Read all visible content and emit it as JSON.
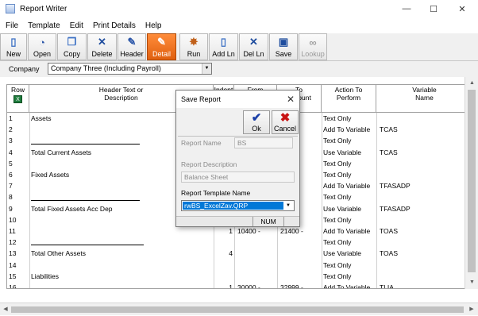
{
  "window": {
    "title": "Report Writer",
    "minimize": "—",
    "maximize": "☐",
    "close": "✕"
  },
  "menu": [
    "File",
    "Template",
    "Edit",
    "Print Details",
    "Help"
  ],
  "toolbar": [
    {
      "label": "New",
      "icon": "new-document-icon",
      "glyph": "▯"
    },
    {
      "label": "Open",
      "icon": "open-icon",
      "glyph": "◔"
    },
    {
      "label": "Copy",
      "icon": "copy-icon",
      "glyph": "❐"
    },
    {
      "label": "Delete",
      "icon": "delete-icon",
      "glyph": "✕"
    },
    {
      "label": "Header",
      "icon": "header-icon",
      "glyph": "✎"
    },
    {
      "label": "Detail",
      "icon": "detail-icon",
      "glyph": "✎"
    },
    {
      "label": "Run",
      "icon": "run-icon",
      "glyph": "✸"
    },
    {
      "label": "Add Ln",
      "icon": "add-line-icon",
      "glyph": "▯"
    },
    {
      "label": "Del Ln",
      "icon": "delete-line-icon",
      "glyph": "✕"
    },
    {
      "label": "Save",
      "icon": "save-icon",
      "glyph": "▣"
    },
    {
      "label": "Lookup",
      "icon": "lookup-icon",
      "glyph": "∞"
    }
  ],
  "company": {
    "label": "Company",
    "value": "Company Three (Including Payroll)"
  },
  "grid": {
    "headers": {
      "row": "Row",
      "header_text": "Header Text or Description",
      "indent": "Indent",
      "from": "From",
      "to": "To",
      "to_sub": "Account",
      "action": "Action To Perform",
      "variable": "Variable Name"
    },
    "rows": [
      {
        "n": "1",
        "text": "Assets",
        "indent": "",
        "from": "",
        "to": "",
        "action": "Text Only",
        "var": ""
      },
      {
        "n": "2",
        "text": "",
        "indent": "",
        "from": "",
        "to": "",
        "action": "Add To Variable",
        "var": "TCAS"
      },
      {
        "n": "3",
        "text": "",
        "indent": "",
        "from": "",
        "to": "",
        "action": "Text Only",
        "var": ""
      },
      {
        "n": "4",
        "text": "Total Current Assets",
        "indent": "",
        "from": "",
        "to": "",
        "action": "Use Variable",
        "var": "TCAS"
      },
      {
        "n": "5",
        "text": "",
        "indent": "",
        "from": "",
        "to": "",
        "action": "Text Only",
        "var": ""
      },
      {
        "n": "6",
        "text": "Fixed Assets",
        "indent": "",
        "from": "",
        "to": "",
        "action": "Text Only",
        "var": ""
      },
      {
        "n": "7",
        "text": "",
        "indent": "",
        "from": "",
        "to": "",
        "action": "Add To Variable",
        "var": "TFASADP"
      },
      {
        "n": "8",
        "text": "",
        "indent": "",
        "from": "",
        "to": "",
        "action": "Text Only",
        "var": ""
      },
      {
        "n": "9",
        "text": "Total Fixed Assets Acc Dep",
        "indent": "",
        "from": "",
        "to": "",
        "action": "Use Variable",
        "var": "TFASADP"
      },
      {
        "n": "10",
        "text": "",
        "indent": "",
        "from": "",
        "to": "",
        "action": "Text Only",
        "var": ""
      },
      {
        "n": "11",
        "text": "",
        "indent": "1",
        "from": "10400 -",
        "to": "21400 -",
        "action": "Add To Variable",
        "var": "TOAS"
      },
      {
        "n": "12",
        "text": "",
        "indent": "",
        "from": "",
        "to": "",
        "action": "Text Only",
        "var": ""
      },
      {
        "n": "13",
        "text": "Total Other Assets",
        "indent": "4",
        "from": "",
        "to": "",
        "action": "Use Variable",
        "var": "TOAS"
      },
      {
        "n": "14",
        "text": "",
        "indent": "",
        "from": "",
        "to": "",
        "action": "Text Only",
        "var": ""
      },
      {
        "n": "15",
        "text": "Liabilities",
        "indent": "",
        "from": "",
        "to": "",
        "action": "Text Only",
        "var": ""
      },
      {
        "n": "16",
        "text": "",
        "indent": "1",
        "from": "30000 -",
        "to": "32999 -",
        "action": "Add To Variable",
        "var": "TLIA"
      }
    ]
  },
  "dialog": {
    "title": "Save Report",
    "ok_label": "Ok",
    "cancel_label": "Cancel",
    "report_name_label": "Report Name",
    "report_name_value": "BS",
    "report_description_label": "Report Description",
    "report_description_value": "Balance Sheet",
    "template_name_label": "Report Template Name",
    "template_name_value": "rwBS_ExcelZav.QRP",
    "status_num": "NUM"
  },
  "colors": {
    "active_tab": "#e06010",
    "selection": "#0078d7",
    "ok_check": "#1a3fa8",
    "cancel_x": "#c81414"
  }
}
